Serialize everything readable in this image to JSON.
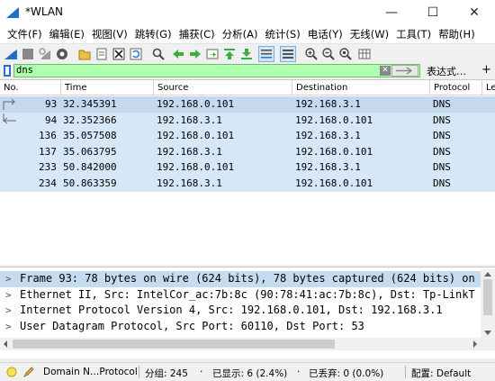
{
  "window": {
    "title": "*WLAN",
    "minimize": "—",
    "maximize": "☐",
    "close": "✕"
  },
  "menu": [
    "文件(F)",
    "编辑(E)",
    "视图(V)",
    "跳转(G)",
    "捕获(C)",
    "分析(A)",
    "统计(S)",
    "电话(Y)",
    "无线(W)",
    "工具(T)",
    "帮助(H)"
  ],
  "filter": {
    "value": "dns",
    "expression_label": "表达式…",
    "add_label": "+",
    "clear_label": "✕"
  },
  "columns": {
    "no": "No.",
    "time": "Time",
    "source": "Source",
    "destination": "Destination",
    "protocol": "Protocol",
    "length": "Le"
  },
  "packets": [
    {
      "no": "93",
      "time": "32.345391",
      "source": "192.168.0.101",
      "destination": "192.168.3.1",
      "protocol": "DNS"
    },
    {
      "no": "94",
      "time": "32.352366",
      "source": "192.168.3.1",
      "destination": "192.168.0.101",
      "protocol": "DNS"
    },
    {
      "no": "136",
      "time": "35.057508",
      "source": "192.168.0.101",
      "destination": "192.168.3.1",
      "protocol": "DNS"
    },
    {
      "no": "137",
      "time": "35.063795",
      "source": "192.168.3.1",
      "destination": "192.168.0.101",
      "protocol": "DNS"
    },
    {
      "no": "233",
      "time": "50.842000",
      "source": "192.168.0.101",
      "destination": "192.168.3.1",
      "protocol": "DNS"
    },
    {
      "no": "234",
      "time": "50.863359",
      "source": "192.168.3.1",
      "destination": "192.168.0.101",
      "protocol": "DNS"
    }
  ],
  "details": [
    "Frame 93: 78 bytes on wire (624 bits), 78 bytes captured (624 bits) on",
    "Ethernet II, Src: IntelCor_ac:7b:8c (90:78:41:ac:7b:8c), Dst: Tp-LinkT",
    "Internet Protocol Version 4, Src: 192.168.0.101, Dst: 192.168.3.1",
    "User Datagram Protocol, Src Port: 60110, Dst Port: 53"
  ],
  "status": {
    "profile_field": "Domain N…Protocol",
    "packets": "分组: 245",
    "displayed": "已显示: 6 (2.4%)",
    "dropped": "已丢弃: 0 (0.0%)",
    "profile": "配置: Default"
  },
  "colors": {
    "row_bg": "#d6e8f7",
    "selected_row": "#c5d9ee",
    "filter_valid": "#afffaf"
  }
}
